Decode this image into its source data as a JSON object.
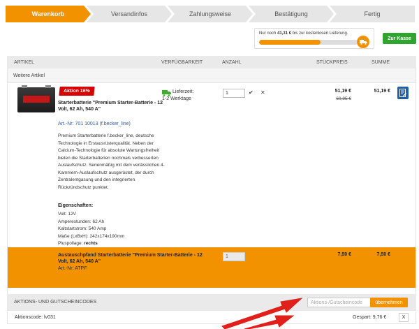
{
  "steps": [
    {
      "label": "Warenkorb",
      "active": true
    },
    {
      "label": "Versandinfos",
      "active": false
    },
    {
      "label": "Zahlungsweise",
      "active": false
    },
    {
      "label": "Bestätigung",
      "active": false
    },
    {
      "label": "Fertig",
      "active": false
    }
  ],
  "shipping": {
    "prefix": "Nur noch",
    "amount": "41,31 €",
    "suffix": "bis zur kostenlosen Lieferung.",
    "progress_fraction": 0.62
  },
  "checkout_button": "Zur Kasse",
  "table": {
    "headers": {
      "article": "ARTIKEL",
      "availability": "VERFÜGBARKEIT",
      "quantity": "ANZAHL",
      "unit_price": "STÜCKPREIS",
      "total": "SUMME"
    },
    "section_label": "Weitere Artikel"
  },
  "item": {
    "badge": "Aktion 16%",
    "title": "Starterbatterie \"Premium Starter-Batterie - 12 Volt, 62 Ah, 540 A\"",
    "article_no": "Art.-Nr: 701 10013 (f.becker_line)",
    "description": "Premium Starterbatterie f.becker_line, deutsche Technologie in Erstausrüsterqualität. Neben der Calcium-Technologie für absolute Wartungsfreiheit bieten die Starterbatterien nochmals verbesserten Auslaufschutz. Serienmäßig mit dem verlässlichen 4-Kammern-Auslaufschutz ausgerüstet, der durch Zentralentgasung und den integrierten Rückzündschutz punktet.",
    "props_heading": "Eigenschaften:",
    "props": [
      "Volt: 12V",
      "Amperestunden: 62 Ah",
      "Kaltstartstrom: 540 Amp",
      "Maße (LxBxH): 242x174x190mm"
    ],
    "pole_label": "Pluspollage:",
    "pole_value": "rechts",
    "delivery_label": "Lieferzeit:",
    "delivery_value": "1-2 Werktage",
    "quantity": "1",
    "price": "51,19 €",
    "old_price": "60,95 €",
    "sum": "51,19 €"
  },
  "deposit": {
    "title": "Austauschpfand Starterbatterie \"Premium Starter-Batterie - 12 Volt, 62 Ah, 540 A\"",
    "article_no": "Art.-Nr: ATPF",
    "quantity": "1",
    "price": "7,50 €",
    "sum": "7,50 €"
  },
  "promo": {
    "title": "AKTIONS- UND GUTSCHEINCODES",
    "placeholder": "Aktions-/Gutscheincode",
    "button": "übernehmen",
    "code_text": "Aktionscode: lv031",
    "saved": "Gespart: 9,76 €",
    "remove": "X"
  },
  "colors": {
    "accent": "#f39200",
    "checkout_green": "#2fa52f",
    "badge_red": "#d60000",
    "arrow_red": "#e0201b"
  }
}
